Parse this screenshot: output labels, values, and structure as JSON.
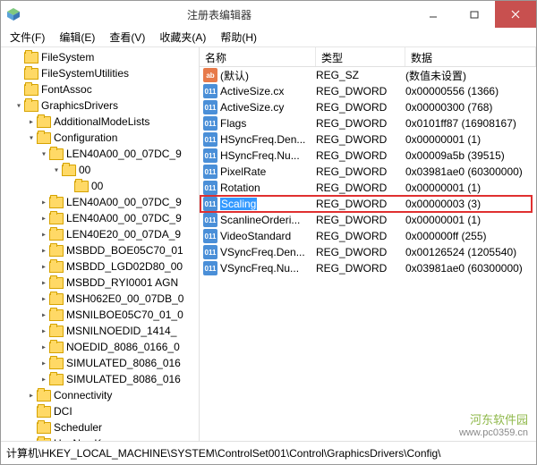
{
  "window": {
    "title": "注册表编辑器"
  },
  "menu": [
    "文件(F)",
    "编辑(E)",
    "查看(V)",
    "收藏夹(A)",
    "帮助(H)"
  ],
  "tree": [
    {
      "indent": 1,
      "exp": "",
      "label": "FileSystem"
    },
    {
      "indent": 1,
      "exp": "",
      "label": "FileSystemUtilities"
    },
    {
      "indent": 1,
      "exp": "",
      "label": "FontAssoc"
    },
    {
      "indent": 1,
      "exp": "▾",
      "label": "GraphicsDrivers"
    },
    {
      "indent": 2,
      "exp": "▸",
      "label": "AdditionalModeLists"
    },
    {
      "indent": 2,
      "exp": "▾",
      "label": "Configuration"
    },
    {
      "indent": 3,
      "exp": "▾",
      "label": "LEN40A00_00_07DC_9"
    },
    {
      "indent": 4,
      "exp": "▾",
      "label": "00"
    },
    {
      "indent": 5,
      "exp": "",
      "label": "00"
    },
    {
      "indent": 3,
      "exp": "▸",
      "label": "LEN40A00_00_07DC_9"
    },
    {
      "indent": 3,
      "exp": "▸",
      "label": "LEN40A00_00_07DC_9"
    },
    {
      "indent": 3,
      "exp": "▸",
      "label": "LEN40E20_00_07DA_9"
    },
    {
      "indent": 3,
      "exp": "▸",
      "label": "MSBDD_BOE05C70_01"
    },
    {
      "indent": 3,
      "exp": "▸",
      "label": "MSBDD_LGD02D80_00"
    },
    {
      "indent": 3,
      "exp": "▸",
      "label": "MSBDD_RYI0001 AGN"
    },
    {
      "indent": 3,
      "exp": "▸",
      "label": "MSH062E0_00_07DB_0"
    },
    {
      "indent": 3,
      "exp": "▸",
      "label": "MSNILBOE05C70_01_0"
    },
    {
      "indent": 3,
      "exp": "▸",
      "label": "MSNILNOEDID_1414_"
    },
    {
      "indent": 3,
      "exp": "▸",
      "label": "NOEDID_8086_0166_0"
    },
    {
      "indent": 3,
      "exp": "▸",
      "label": "SIMULATED_8086_016"
    },
    {
      "indent": 3,
      "exp": "▸",
      "label": "SIMULATED_8086_016"
    },
    {
      "indent": 2,
      "exp": "▸",
      "label": "Connectivity"
    },
    {
      "indent": 2,
      "exp": "",
      "label": "DCI"
    },
    {
      "indent": 2,
      "exp": "",
      "label": "Scheduler"
    },
    {
      "indent": 2,
      "exp": "",
      "label": "UseNewKey"
    }
  ],
  "cols": {
    "name": "名称",
    "type": "类型",
    "data": "数据"
  },
  "rows": [
    {
      "icon": "sz",
      "name": "(默认)",
      "type": "REG_SZ",
      "data": "(数值未设置)",
      "sel": false
    },
    {
      "icon": "dw",
      "name": "ActiveSize.cx",
      "type": "REG_DWORD",
      "data": "0x00000556 (1366)",
      "sel": false
    },
    {
      "icon": "dw",
      "name": "ActiveSize.cy",
      "type": "REG_DWORD",
      "data": "0x00000300 (768)",
      "sel": false
    },
    {
      "icon": "dw",
      "name": "Flags",
      "type": "REG_DWORD",
      "data": "0x0101ff87 (16908167)",
      "sel": false
    },
    {
      "icon": "dw",
      "name": "HSyncFreq.Den...",
      "type": "REG_DWORD",
      "data": "0x00000001 (1)",
      "sel": false
    },
    {
      "icon": "dw",
      "name": "HSyncFreq.Nu...",
      "type": "REG_DWORD",
      "data": "0x00009a5b (39515)",
      "sel": false
    },
    {
      "icon": "dw",
      "name": "PixelRate",
      "type": "REG_DWORD",
      "data": "0x03981ae0 (60300000)",
      "sel": false
    },
    {
      "icon": "dw",
      "name": "Rotation",
      "type": "REG_DWORD",
      "data": "0x00000001 (1)",
      "sel": false
    },
    {
      "icon": "dw",
      "name": "Scaling",
      "type": "REG_DWORD",
      "data": "0x00000003 (3)",
      "sel": true
    },
    {
      "icon": "dw",
      "name": "ScanlineOrderi...",
      "type": "REG_DWORD",
      "data": "0x00000001 (1)",
      "sel": false
    },
    {
      "icon": "dw",
      "name": "VideoStandard",
      "type": "REG_DWORD",
      "data": "0x000000ff (255)",
      "sel": false
    },
    {
      "icon": "dw",
      "name": "VSyncFreq.Den...",
      "type": "REG_DWORD",
      "data": "0x00126524 (1205540)",
      "sel": false
    },
    {
      "icon": "dw",
      "name": "VSyncFreq.Nu...",
      "type": "REG_DWORD",
      "data": "0x03981ae0 (60300000)",
      "sel": false
    }
  ],
  "status": "计算机\\HKEY_LOCAL_MACHINE\\SYSTEM\\ControlSet001\\Control\\GraphicsDrivers\\Config\\",
  "watermark": {
    "name": "河东软件园",
    "url": "www.pc0359.cn"
  }
}
